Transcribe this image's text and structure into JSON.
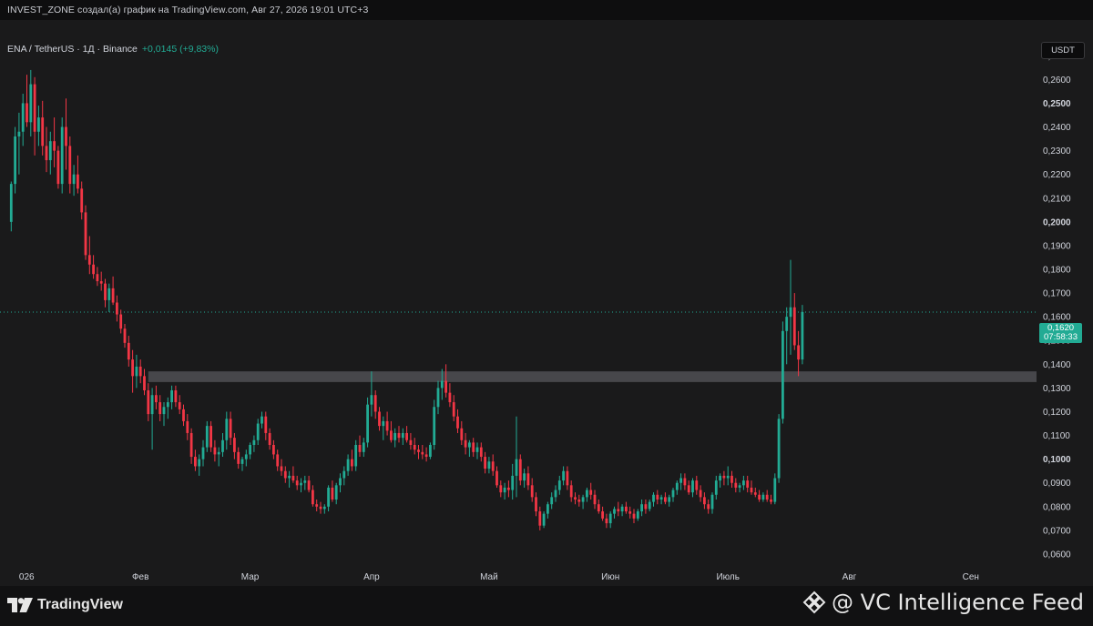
{
  "header": {
    "caption": "INVEST_ZONE создал(а) график на TradingView.com, Авг 27, 2026 19:01 UTC+3"
  },
  "legend": {
    "symbol": "ENA / TetherUS · 1Д · Binance",
    "change": "+0,0145 (+9,83%)"
  },
  "currency_button": "USDT",
  "price_tag": {
    "price": "0,1620",
    "countdown": "07:58:33"
  },
  "footer": {
    "brand": "TradingView",
    "watermark": "@ VC Intelligence Feed",
    "brand_icon": "tradingview-logo-icon",
    "watermark_icon": "binance-diamond-icon"
  },
  "colors": {
    "up": "#22ab94",
    "down": "#f23645",
    "background": "#1a1a1b",
    "zone": "#6e6e72"
  },
  "chart_data": {
    "type": "candlestick",
    "symbol": "ENA / TetherUS",
    "interval": "1Д",
    "exchange": "Binance",
    "ylim": [
      0.055,
      0.282
    ],
    "y_ticks": [
      "0,0600",
      "0,0700",
      "0,0800",
      "0,0900",
      "0,1000",
      "0,1100",
      "0,1200",
      "0,1300",
      "0,1400",
      "0,1500",
      "0,1600",
      "0,1700",
      "0,1800",
      "0,1900",
      "0,2000",
      "0,2100",
      "0,2200",
      "0,2300",
      "0,2400",
      "0,2500",
      "0,2600",
      "0,2700"
    ],
    "bold_ticks": [
      "0,1000",
      "0,1500",
      "0,2000",
      "0,2500"
    ],
    "x_labels": [
      "026",
      "Фев",
      "Мар",
      "Апр",
      "Май",
      "Июн",
      "Июль",
      "Авг",
      "Сен"
    ],
    "x_label_days": [
      3,
      34,
      62,
      93,
      123,
      154,
      184,
      215,
      246
    ],
    "current_price": 0.162,
    "support_zone": [
      0.1325,
      0.137
    ],
    "support_zone_days": [
      36,
      275
    ],
    "candles_start_day": 1,
    "candles": [
      [
        0.2,
        0.217,
        0.196,
        0.216
      ],
      [
        0.216,
        0.24,
        0.212,
        0.236
      ],
      [
        0.236,
        0.246,
        0.22,
        0.238
      ],
      [
        0.238,
        0.254,
        0.232,
        0.25
      ],
      [
        0.25,
        0.262,
        0.24,
        0.242
      ],
      [
        0.242,
        0.264,
        0.236,
        0.258
      ],
      [
        0.258,
        0.261,
        0.228,
        0.238
      ],
      [
        0.238,
        0.249,
        0.232,
        0.244
      ],
      [
        0.244,
        0.251,
        0.228,
        0.232
      ],
      [
        0.232,
        0.24,
        0.221,
        0.226
      ],
      [
        0.226,
        0.238,
        0.22,
        0.234
      ],
      [
        0.234,
        0.244,
        0.223,
        0.23
      ],
      [
        0.23,
        0.232,
        0.214,
        0.216
      ],
      [
        0.216,
        0.244,
        0.212,
        0.24
      ],
      [
        0.24,
        0.252,
        0.222,
        0.232
      ],
      [
        0.232,
        0.236,
        0.212,
        0.216
      ],
      [
        0.216,
        0.224,
        0.211,
        0.22
      ],
      [
        0.22,
        0.228,
        0.212,
        0.214
      ],
      [
        0.214,
        0.217,
        0.201,
        0.204
      ],
      [
        0.204,
        0.207,
        0.184,
        0.186
      ],
      [
        0.186,
        0.194,
        0.178,
        0.182
      ],
      [
        0.182,
        0.186,
        0.176,
        0.178
      ],
      [
        0.178,
        0.181,
        0.173,
        0.175
      ],
      [
        0.175,
        0.179,
        0.171,
        0.174
      ],
      [
        0.174,
        0.176,
        0.164,
        0.167
      ],
      [
        0.167,
        0.174,
        0.162,
        0.172
      ],
      [
        0.172,
        0.177,
        0.165,
        0.166
      ],
      [
        0.166,
        0.169,
        0.158,
        0.161
      ],
      [
        0.161,
        0.163,
        0.153,
        0.155
      ],
      [
        0.155,
        0.157,
        0.147,
        0.149
      ],
      [
        0.149,
        0.152,
        0.139,
        0.142
      ],
      [
        0.142,
        0.146,
        0.128,
        0.135
      ],
      [
        0.135,
        0.144,
        0.13,
        0.139
      ],
      [
        0.139,
        0.142,
        0.132,
        0.135
      ],
      [
        0.135,
        0.138,
        0.127,
        0.129
      ],
      [
        0.129,
        0.132,
        0.116,
        0.119
      ],
      [
        0.119,
        0.13,
        0.104,
        0.127
      ],
      [
        0.127,
        0.131,
        0.121,
        0.124
      ],
      [
        0.124,
        0.127,
        0.116,
        0.119
      ],
      [
        0.119,
        0.124,
        0.114,
        0.122
      ],
      [
        0.122,
        0.126,
        0.117,
        0.124
      ],
      [
        0.124,
        0.131,
        0.121,
        0.129
      ],
      [
        0.129,
        0.131,
        0.122,
        0.124
      ],
      [
        0.124,
        0.127,
        0.119,
        0.121
      ],
      [
        0.121,
        0.123,
        0.114,
        0.116
      ],
      [
        0.116,
        0.119,
        0.108,
        0.111
      ],
      [
        0.111,
        0.113,
        0.098,
        0.101
      ],
      [
        0.101,
        0.104,
        0.095,
        0.097
      ],
      [
        0.097,
        0.102,
        0.093,
        0.1
      ],
      [
        0.1,
        0.108,
        0.097,
        0.105
      ],
      [
        0.105,
        0.116,
        0.103,
        0.114
      ],
      [
        0.114,
        0.116,
        0.103,
        0.105
      ],
      [
        0.105,
        0.108,
        0.099,
        0.102
      ],
      [
        0.102,
        0.105,
        0.097,
        0.103
      ],
      [
        0.103,
        0.111,
        0.101,
        0.108
      ],
      [
        0.108,
        0.12,
        0.104,
        0.117
      ],
      [
        0.117,
        0.12,
        0.106,
        0.109
      ],
      [
        0.109,
        0.111,
        0.1,
        0.103
      ],
      [
        0.103,
        0.105,
        0.096,
        0.098
      ],
      [
        0.098,
        0.101,
        0.095,
        0.1
      ],
      [
        0.1,
        0.104,
        0.097,
        0.102
      ],
      [
        0.102,
        0.107,
        0.1,
        0.106
      ],
      [
        0.106,
        0.11,
        0.103,
        0.108
      ],
      [
        0.108,
        0.117,
        0.106,
        0.115
      ],
      [
        0.115,
        0.12,
        0.113,
        0.118
      ],
      [
        0.118,
        0.12,
        0.108,
        0.111
      ],
      [
        0.111,
        0.113,
        0.104,
        0.106
      ],
      [
        0.106,
        0.108,
        0.1,
        0.102
      ],
      [
        0.102,
        0.104,
        0.095,
        0.097
      ],
      [
        0.097,
        0.1,
        0.093,
        0.095
      ],
      [
        0.095,
        0.097,
        0.09,
        0.092
      ],
      [
        0.092,
        0.095,
        0.088,
        0.093
      ],
      [
        0.093,
        0.097,
        0.09,
        0.091
      ],
      [
        0.091,
        0.093,
        0.087,
        0.089
      ],
      [
        0.089,
        0.092,
        0.086,
        0.09
      ],
      [
        0.09,
        0.093,
        0.087,
        0.091
      ],
      [
        0.091,
        0.093,
        0.086,
        0.087
      ],
      [
        0.087,
        0.089,
        0.08,
        0.081
      ],
      [
        0.081,
        0.083,
        0.078,
        0.08
      ],
      [
        0.08,
        0.082,
        0.077,
        0.079
      ],
      [
        0.079,
        0.081,
        0.077,
        0.08
      ],
      [
        0.08,
        0.089,
        0.078,
        0.088
      ],
      [
        0.088,
        0.091,
        0.082,
        0.083
      ],
      [
        0.083,
        0.09,
        0.081,
        0.089
      ],
      [
        0.089,
        0.094,
        0.086,
        0.092
      ],
      [
        0.092,
        0.097,
        0.089,
        0.095
      ],
      [
        0.095,
        0.102,
        0.093,
        0.1
      ],
      [
        0.1,
        0.104,
        0.095,
        0.097
      ],
      [
        0.097,
        0.108,
        0.095,
        0.106
      ],
      [
        0.106,
        0.11,
        0.101,
        0.103
      ],
      [
        0.103,
        0.109,
        0.101,
        0.107
      ],
      [
        0.107,
        0.126,
        0.105,
        0.123
      ],
      [
        0.123,
        0.137,
        0.118,
        0.127
      ],
      [
        0.127,
        0.129,
        0.117,
        0.12
      ],
      [
        0.12,
        0.122,
        0.112,
        0.114
      ],
      [
        0.114,
        0.118,
        0.108,
        0.116
      ],
      [
        0.116,
        0.12,
        0.11,
        0.112
      ],
      [
        0.112,
        0.116,
        0.107,
        0.108
      ],
      [
        0.108,
        0.113,
        0.105,
        0.111
      ],
      [
        0.111,
        0.114,
        0.107,
        0.109
      ],
      [
        0.109,
        0.113,
        0.106,
        0.111
      ],
      [
        0.111,
        0.114,
        0.107,
        0.108
      ],
      [
        0.108,
        0.111,
        0.104,
        0.106
      ],
      [
        0.106,
        0.109,
        0.102,
        0.104
      ],
      [
        0.104,
        0.106,
        0.1,
        0.103
      ],
      [
        0.103,
        0.106,
        0.1,
        0.102
      ],
      [
        0.102,
        0.105,
        0.099,
        0.101
      ],
      [
        0.101,
        0.107,
        0.1,
        0.106
      ],
      [
        0.106,
        0.125,
        0.104,
        0.122
      ],
      [
        0.122,
        0.133,
        0.119,
        0.13
      ],
      [
        0.13,
        0.138,
        0.125,
        0.133
      ],
      [
        0.133,
        0.14,
        0.126,
        0.128
      ],
      [
        0.128,
        0.132,
        0.122,
        0.124
      ],
      [
        0.124,
        0.127,
        0.116,
        0.118
      ],
      [
        0.118,
        0.121,
        0.111,
        0.113
      ],
      [
        0.113,
        0.116,
        0.106,
        0.108
      ],
      [
        0.108,
        0.111,
        0.102,
        0.105
      ],
      [
        0.105,
        0.108,
        0.101,
        0.107
      ],
      [
        0.107,
        0.109,
        0.101,
        0.103
      ],
      [
        0.103,
        0.107,
        0.1,
        0.105
      ],
      [
        0.105,
        0.107,
        0.099,
        0.101
      ],
      [
        0.101,
        0.103,
        0.094,
        0.096
      ],
      [
        0.096,
        0.101,
        0.094,
        0.099
      ],
      [
        0.099,
        0.102,
        0.093,
        0.095
      ],
      [
        0.095,
        0.097,
        0.088,
        0.089
      ],
      [
        0.089,
        0.091,
        0.084,
        0.086
      ],
      [
        0.086,
        0.09,
        0.083,
        0.088
      ],
      [
        0.088,
        0.091,
        0.084,
        0.087
      ],
      [
        0.087,
        0.098,
        0.083,
        0.093
      ],
      [
        0.093,
        0.118,
        0.084,
        0.1
      ],
      [
        0.1,
        0.102,
        0.089,
        0.091
      ],
      [
        0.091,
        0.096,
        0.088,
        0.094
      ],
      [
        0.094,
        0.097,
        0.087,
        0.089
      ],
      [
        0.089,
        0.092,
        0.082,
        0.084
      ],
      [
        0.084,
        0.086,
        0.076,
        0.078
      ],
      [
        0.078,
        0.08,
        0.07,
        0.072
      ],
      [
        0.072,
        0.078,
        0.071,
        0.077
      ],
      [
        0.077,
        0.082,
        0.075,
        0.081
      ],
      [
        0.081,
        0.086,
        0.079,
        0.084
      ],
      [
        0.084,
        0.089,
        0.082,
        0.087
      ],
      [
        0.087,
        0.093,
        0.085,
        0.091
      ],
      [
        0.091,
        0.097,
        0.089,
        0.095
      ],
      [
        0.095,
        0.097,
        0.087,
        0.089
      ],
      [
        0.089,
        0.091,
        0.082,
        0.084
      ],
      [
        0.084,
        0.086,
        0.081,
        0.083
      ],
      [
        0.083,
        0.085,
        0.08,
        0.082
      ],
      [
        0.082,
        0.085,
        0.079,
        0.084
      ],
      [
        0.084,
        0.088,
        0.082,
        0.087
      ],
      [
        0.087,
        0.09,
        0.083,
        0.085
      ],
      [
        0.085,
        0.087,
        0.079,
        0.081
      ],
      [
        0.081,
        0.083,
        0.077,
        0.078
      ],
      [
        0.078,
        0.08,
        0.074,
        0.075
      ],
      [
        0.075,
        0.077,
        0.071,
        0.073
      ],
      [
        0.073,
        0.078,
        0.071,
        0.077
      ],
      [
        0.077,
        0.08,
        0.075,
        0.079
      ],
      [
        0.079,
        0.082,
        0.076,
        0.078
      ],
      [
        0.078,
        0.081,
        0.076,
        0.08
      ],
      [
        0.08,
        0.082,
        0.077,
        0.078
      ],
      [
        0.078,
        0.08,
        0.075,
        0.077
      ],
      [
        0.077,
        0.079,
        0.073,
        0.075
      ],
      [
        0.075,
        0.079,
        0.074,
        0.078
      ],
      [
        0.078,
        0.083,
        0.076,
        0.081
      ],
      [
        0.081,
        0.083,
        0.077,
        0.079
      ],
      [
        0.079,
        0.083,
        0.078,
        0.082
      ],
      [
        0.082,
        0.086,
        0.08,
        0.085
      ],
      [
        0.085,
        0.087,
        0.081,
        0.083
      ],
      [
        0.083,
        0.085,
        0.081,
        0.084
      ],
      [
        0.084,
        0.086,
        0.081,
        0.082
      ],
      [
        0.082,
        0.085,
        0.08,
        0.084
      ],
      [
        0.084,
        0.088,
        0.082,
        0.087
      ],
      [
        0.087,
        0.091,
        0.085,
        0.09
      ],
      [
        0.09,
        0.094,
        0.087,
        0.092
      ],
      [
        0.092,
        0.094,
        0.087,
        0.089
      ],
      [
        0.089,
        0.091,
        0.085,
        0.086
      ],
      [
        0.086,
        0.092,
        0.084,
        0.091
      ],
      [
        0.091,
        0.093,
        0.085,
        0.087
      ],
      [
        0.087,
        0.089,
        0.082,
        0.084
      ],
      [
        0.084,
        0.086,
        0.079,
        0.081
      ],
      [
        0.081,
        0.083,
        0.077,
        0.079
      ],
      [
        0.079,
        0.086,
        0.077,
        0.085
      ],
      [
        0.085,
        0.093,
        0.083,
        0.091
      ],
      [
        0.091,
        0.094,
        0.088,
        0.093
      ],
      [
        0.093,
        0.095,
        0.089,
        0.092
      ],
      [
        0.092,
        0.097,
        0.089,
        0.093
      ],
      [
        0.093,
        0.095,
        0.088,
        0.09
      ],
      [
        0.09,
        0.092,
        0.086,
        0.088
      ],
      [
        0.088,
        0.09,
        0.086,
        0.089
      ],
      [
        0.089,
        0.093,
        0.087,
        0.091
      ],
      [
        0.091,
        0.093,
        0.086,
        0.088
      ],
      [
        0.088,
        0.091,
        0.085,
        0.086
      ],
      [
        0.086,
        0.088,
        0.084,
        0.085
      ],
      [
        0.085,
        0.087,
        0.082,
        0.083
      ],
      [
        0.083,
        0.086,
        0.082,
        0.085
      ],
      [
        0.085,
        0.087,
        0.082,
        0.083
      ],
      [
        0.083,
        0.085,
        0.081,
        0.082
      ],
      [
        0.082,
        0.094,
        0.081,
        0.092
      ],
      [
        0.092,
        0.119,
        0.09,
        0.117
      ],
      [
        0.117,
        0.158,
        0.115,
        0.154
      ],
      [
        0.154,
        0.164,
        0.14,
        0.16
      ],
      [
        0.16,
        0.184,
        0.144,
        0.164
      ],
      [
        0.164,
        0.17,
        0.146,
        0.148
      ],
      [
        0.148,
        0.154,
        0.135,
        0.142
      ],
      [
        0.142,
        0.165,
        0.14,
        0.162
      ]
    ]
  }
}
